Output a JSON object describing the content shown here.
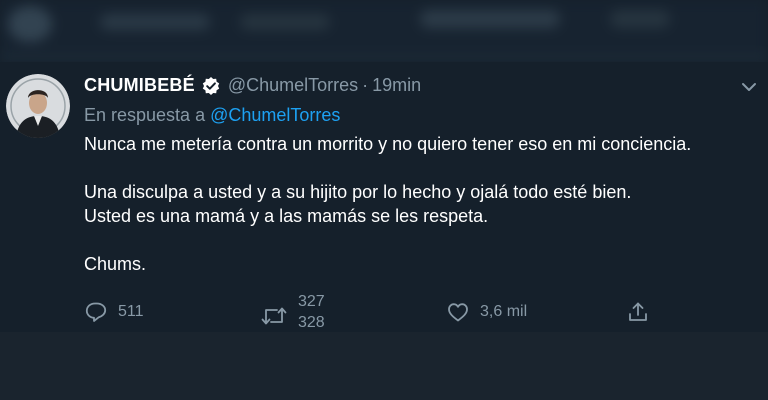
{
  "tweet": {
    "display_name": "CHUMIBEBÉ",
    "handle": "@ChumelTorres",
    "separator": "·",
    "time": "19min",
    "reply_prefix": "En respuesta a",
    "reply_handle": "@ChumelTorres",
    "lines": [
      "Nunca me metería contra un morrito y no quiero tener eso en mi conciencia.",
      "Una disculpa a usted y a su hijito por lo hecho y ojalá todo esté bien.",
      "Usted es una mamá y a las mamás se les respeta.",
      "Chums."
    ]
  },
  "actions": {
    "reply_count": "511",
    "retweet_count": "327",
    "retweet_count_next": "328",
    "like_count": "3,6 mil"
  },
  "icons": {
    "verified": "verified-badge-icon",
    "chevron": "chevron-down-icon",
    "reply": "reply-bubble-icon",
    "retweet": "retweet-icon",
    "like": "heart-icon",
    "share": "share-upload-icon"
  },
  "colors": {
    "background": "#15202b",
    "muted_text": "#8899a6",
    "link": "#1da1f2"
  }
}
